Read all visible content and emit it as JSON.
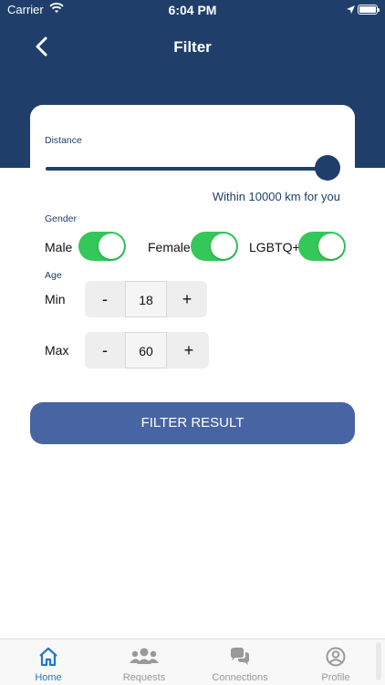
{
  "status": {
    "carrier": "Carrier",
    "time": "6:04 PM"
  },
  "header": {
    "title": "Filter"
  },
  "distance": {
    "label": "Distance",
    "summary": "Within 10000 km for you",
    "slider_fraction": 1.0
  },
  "gender": {
    "label": "Gender",
    "options": [
      {
        "label": "Male",
        "on": true
      },
      {
        "label": "Female",
        "on": true
      },
      {
        "label": "LGBTQ+",
        "on": true
      }
    ]
  },
  "age": {
    "label": "Age",
    "min": {
      "label": "Min",
      "value": "18"
    },
    "max": {
      "label": "Max",
      "value": "60"
    },
    "minus": "-",
    "plus": "+"
  },
  "filter_button": "FILTER RESULT",
  "tabs": [
    {
      "label": "Home",
      "active": true
    },
    {
      "label": "Requests",
      "active": false
    },
    {
      "label": "Connections",
      "active": false
    },
    {
      "label": "Profile",
      "active": false
    }
  ],
  "colors": {
    "primary": "#1f3f6a",
    "button": "#4765a3",
    "toggle_on": "#34c759",
    "tab_active": "#2277d0"
  }
}
